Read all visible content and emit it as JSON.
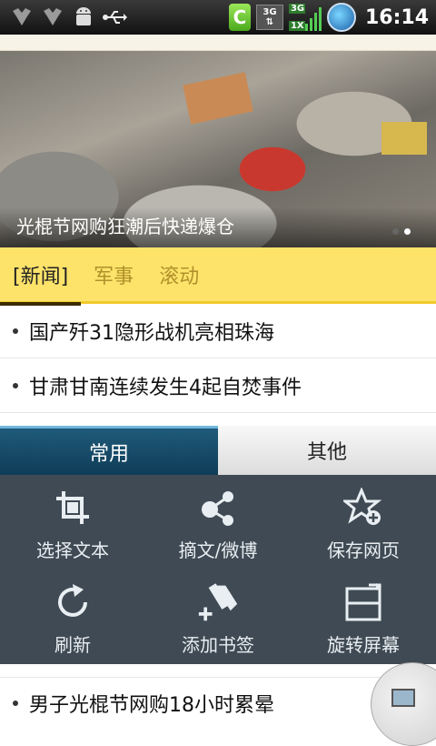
{
  "status_bar": {
    "clock": "16:14",
    "icons": [
      "notification-icon",
      "notification-icon",
      "android-debug-icon",
      "usb-icon"
    ],
    "right_icons": [
      "c-app-icon",
      "3g-data-icon",
      "signal-3g-icon",
      "globe-icon"
    ],
    "tg_label": "3G",
    "net_label_top": "3G",
    "net_label_bottom": "1X"
  },
  "banner": {
    "caption": "光棍节网购狂潮后快递爆仓",
    "dots": 2,
    "active_dot": 1
  },
  "tabs": [
    {
      "label": "[新闻]",
      "active": true
    },
    {
      "label": "军事",
      "active": false
    },
    {
      "label": "滚动",
      "active": false
    }
  ],
  "news": [
    "国产歼31隐形战机亮相珠海",
    "甘肃甘南连续发生4起自焚事件"
  ],
  "menu": {
    "tabs": [
      {
        "label": "常用",
        "active": true
      },
      {
        "label": "其他",
        "active": false
      }
    ],
    "items": [
      {
        "label": "选择文本",
        "icon": "crop-icon"
      },
      {
        "label": "摘文/微博",
        "icon": "share-icon"
      },
      {
        "label": "保存网页",
        "icon": "star-add-icon"
      },
      {
        "label": "刷新",
        "icon": "refresh-icon"
      },
      {
        "label": "添加书签",
        "icon": "bookmark-add-icon"
      },
      {
        "label": "旋转屏幕",
        "icon": "rotate-screen-icon"
      }
    ]
  },
  "bottom_news": "男子光棍节网购18小时累晕",
  "colors": {
    "tab_bar": "#fde36a",
    "menu_bg": "#3f4a54",
    "menu_active_tab": "#0f3d57"
  }
}
